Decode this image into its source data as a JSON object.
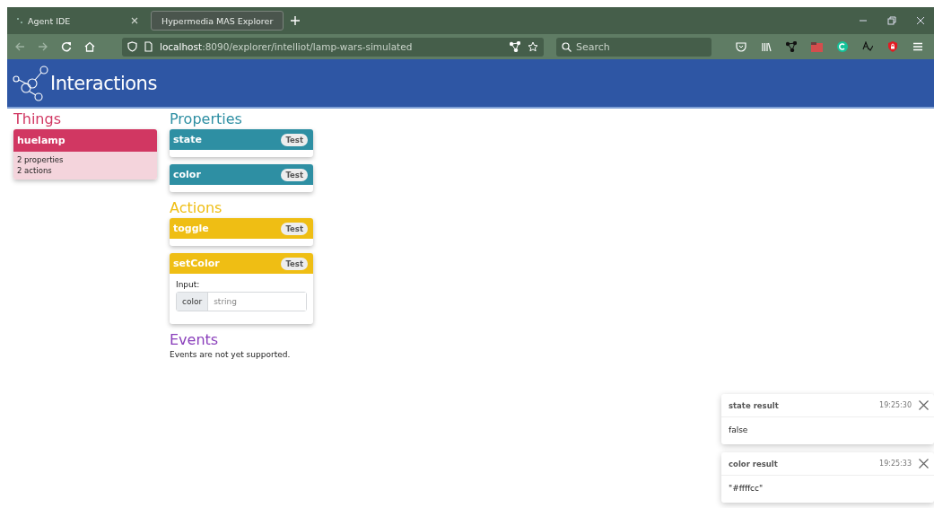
{
  "browser": {
    "tabs": [
      {
        "title": "Agent IDE",
        "selected": false
      },
      {
        "title": "Hypermedia MAS Explorer",
        "selected": true
      }
    ],
    "url": {
      "host": "localhost",
      "path": ":8090/explorer/intelliot/lamp-wars-simulated"
    },
    "search": {
      "placeholder": "Search"
    }
  },
  "header": {
    "title": "Interactions"
  },
  "things": {
    "heading": "Things",
    "items": [
      {
        "name": "huelamp",
        "lines": [
          "2 properties",
          "2 actions"
        ]
      }
    ]
  },
  "sections": [
    {
      "kind": "properties",
      "heading": "Properties",
      "cards": [
        {
          "name": "state",
          "button": "Test"
        },
        {
          "name": "color",
          "button": "Test"
        }
      ]
    },
    {
      "kind": "actions",
      "heading": "Actions",
      "cards": [
        {
          "name": "toggle",
          "button": "Test"
        },
        {
          "name": "setColor",
          "button": "Test",
          "input": {
            "label": "Input:",
            "param": "color",
            "placeholder": "string"
          }
        }
      ]
    },
    {
      "kind": "events",
      "heading": "Events",
      "note": "Events are not yet supported."
    }
  ],
  "toasts": [
    {
      "title": "state result",
      "time": "19:25:30",
      "body": "false"
    },
    {
      "title": "color result",
      "time": "19:25:33",
      "body": "\"#ffffcc\""
    }
  ]
}
